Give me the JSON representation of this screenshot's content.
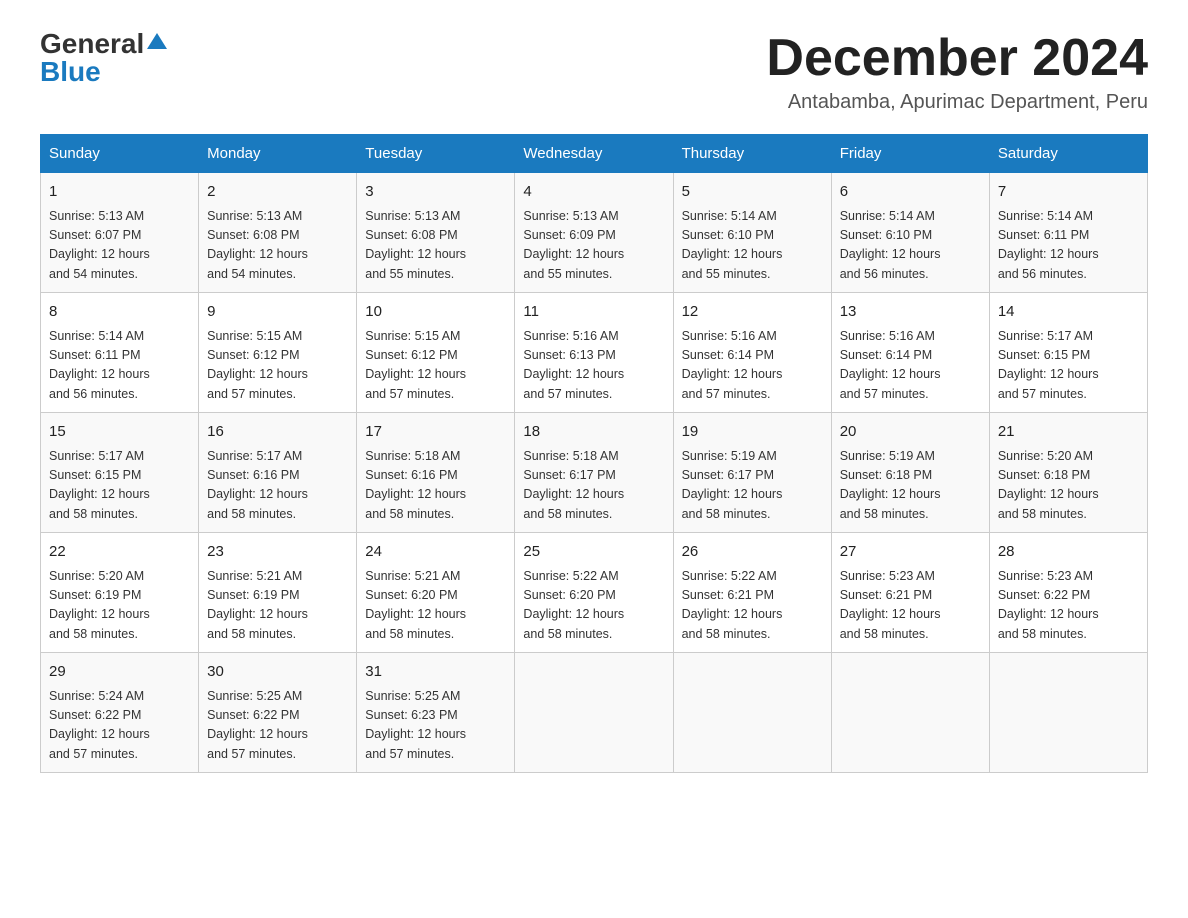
{
  "logo": {
    "general": "General",
    "blue": "Blue"
  },
  "header": {
    "month": "December 2024",
    "location": "Antabamba, Apurimac Department, Peru"
  },
  "days_of_week": [
    "Sunday",
    "Monday",
    "Tuesday",
    "Wednesday",
    "Thursday",
    "Friday",
    "Saturday"
  ],
  "weeks": [
    [
      {
        "day": "1",
        "sunrise": "5:13 AM",
        "sunset": "6:07 PM",
        "daylight": "12 hours and 54 minutes."
      },
      {
        "day": "2",
        "sunrise": "5:13 AM",
        "sunset": "6:08 PM",
        "daylight": "12 hours and 54 minutes."
      },
      {
        "day": "3",
        "sunrise": "5:13 AM",
        "sunset": "6:08 PM",
        "daylight": "12 hours and 55 minutes."
      },
      {
        "day": "4",
        "sunrise": "5:13 AM",
        "sunset": "6:09 PM",
        "daylight": "12 hours and 55 minutes."
      },
      {
        "day": "5",
        "sunrise": "5:14 AM",
        "sunset": "6:10 PM",
        "daylight": "12 hours and 55 minutes."
      },
      {
        "day": "6",
        "sunrise": "5:14 AM",
        "sunset": "6:10 PM",
        "daylight": "12 hours and 56 minutes."
      },
      {
        "day": "7",
        "sunrise": "5:14 AM",
        "sunset": "6:11 PM",
        "daylight": "12 hours and 56 minutes."
      }
    ],
    [
      {
        "day": "8",
        "sunrise": "5:14 AM",
        "sunset": "6:11 PM",
        "daylight": "12 hours and 56 minutes."
      },
      {
        "day": "9",
        "sunrise": "5:15 AM",
        "sunset": "6:12 PM",
        "daylight": "12 hours and 57 minutes."
      },
      {
        "day": "10",
        "sunrise": "5:15 AM",
        "sunset": "6:12 PM",
        "daylight": "12 hours and 57 minutes."
      },
      {
        "day": "11",
        "sunrise": "5:16 AM",
        "sunset": "6:13 PM",
        "daylight": "12 hours and 57 minutes."
      },
      {
        "day": "12",
        "sunrise": "5:16 AM",
        "sunset": "6:14 PM",
        "daylight": "12 hours and 57 minutes."
      },
      {
        "day": "13",
        "sunrise": "5:16 AM",
        "sunset": "6:14 PM",
        "daylight": "12 hours and 57 minutes."
      },
      {
        "day": "14",
        "sunrise": "5:17 AM",
        "sunset": "6:15 PM",
        "daylight": "12 hours and 57 minutes."
      }
    ],
    [
      {
        "day": "15",
        "sunrise": "5:17 AM",
        "sunset": "6:15 PM",
        "daylight": "12 hours and 58 minutes."
      },
      {
        "day": "16",
        "sunrise": "5:17 AM",
        "sunset": "6:16 PM",
        "daylight": "12 hours and 58 minutes."
      },
      {
        "day": "17",
        "sunrise": "5:18 AM",
        "sunset": "6:16 PM",
        "daylight": "12 hours and 58 minutes."
      },
      {
        "day": "18",
        "sunrise": "5:18 AM",
        "sunset": "6:17 PM",
        "daylight": "12 hours and 58 minutes."
      },
      {
        "day": "19",
        "sunrise": "5:19 AM",
        "sunset": "6:17 PM",
        "daylight": "12 hours and 58 minutes."
      },
      {
        "day": "20",
        "sunrise": "5:19 AM",
        "sunset": "6:18 PM",
        "daylight": "12 hours and 58 minutes."
      },
      {
        "day": "21",
        "sunrise": "5:20 AM",
        "sunset": "6:18 PM",
        "daylight": "12 hours and 58 minutes."
      }
    ],
    [
      {
        "day": "22",
        "sunrise": "5:20 AM",
        "sunset": "6:19 PM",
        "daylight": "12 hours and 58 minutes."
      },
      {
        "day": "23",
        "sunrise": "5:21 AM",
        "sunset": "6:19 PM",
        "daylight": "12 hours and 58 minutes."
      },
      {
        "day": "24",
        "sunrise": "5:21 AM",
        "sunset": "6:20 PM",
        "daylight": "12 hours and 58 minutes."
      },
      {
        "day": "25",
        "sunrise": "5:22 AM",
        "sunset": "6:20 PM",
        "daylight": "12 hours and 58 minutes."
      },
      {
        "day": "26",
        "sunrise": "5:22 AM",
        "sunset": "6:21 PM",
        "daylight": "12 hours and 58 minutes."
      },
      {
        "day": "27",
        "sunrise": "5:23 AM",
        "sunset": "6:21 PM",
        "daylight": "12 hours and 58 minutes."
      },
      {
        "day": "28",
        "sunrise": "5:23 AM",
        "sunset": "6:22 PM",
        "daylight": "12 hours and 58 minutes."
      }
    ],
    [
      {
        "day": "29",
        "sunrise": "5:24 AM",
        "sunset": "6:22 PM",
        "daylight": "12 hours and 57 minutes."
      },
      {
        "day": "30",
        "sunrise": "5:25 AM",
        "sunset": "6:22 PM",
        "daylight": "12 hours and 57 minutes."
      },
      {
        "day": "31",
        "sunrise": "5:25 AM",
        "sunset": "6:23 PM",
        "daylight": "12 hours and 57 minutes."
      },
      null,
      null,
      null,
      null
    ]
  ],
  "labels": {
    "sunrise": "Sunrise:",
    "sunset": "Sunset:",
    "daylight": "Daylight:"
  }
}
